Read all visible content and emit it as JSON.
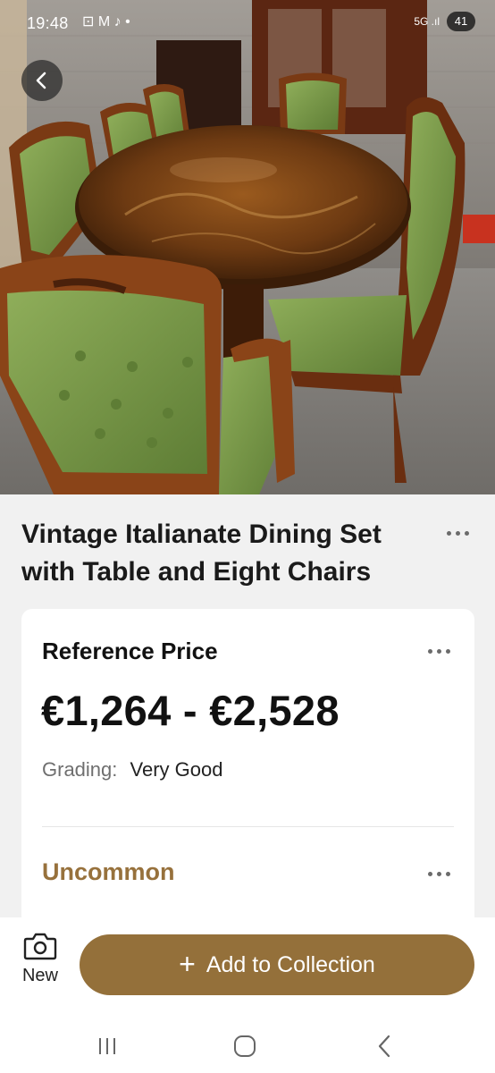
{
  "status_bar": {
    "time": "19:48",
    "apps": "⊡ M ♪ •",
    "network": "5G .ıl",
    "battery": "41"
  },
  "item": {
    "title": "Vintage Italianate Dining Set with Table and Eight Chairs"
  },
  "price_card": {
    "heading": "Reference Price",
    "price_range": "€1,264 - €2,528",
    "grading_label": "Grading:",
    "grading_value": "Very Good",
    "rarity": "Uncommon"
  },
  "actions": {
    "new_label": "New",
    "add_label": "Add to Collection"
  },
  "colors": {
    "accent": "#94703a",
    "rarity_text": "#97713c",
    "background": "#f1f1f1"
  },
  "icons": [
    "back-arrow-icon",
    "more-icon",
    "camera-icon",
    "plus-icon",
    "recent-apps-icon",
    "home-icon",
    "back-icon"
  ]
}
